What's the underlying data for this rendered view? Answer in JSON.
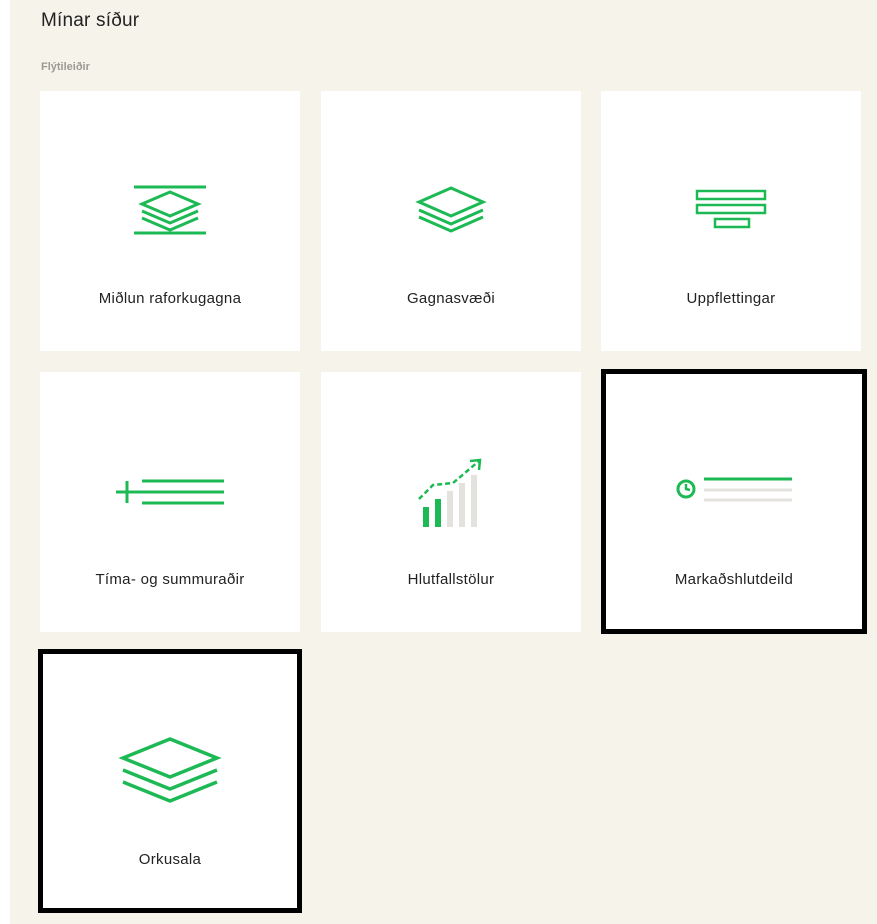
{
  "page": {
    "title": "Mínar síður",
    "subtitle": "Flýtileiðir"
  },
  "accent_color": "#1db954",
  "tiles": [
    {
      "label": "Miðlun raforkugagna",
      "icon": "layers-bracket-icon",
      "selected": false
    },
    {
      "label": "Gagnasvæði",
      "icon": "layers-icon",
      "selected": false
    },
    {
      "label": "Uppflettingar",
      "icon": "stacked-bars-icon",
      "selected": false
    },
    {
      "label": "Tíma- og summuraðir",
      "icon": "plus-lines-icon",
      "selected": false
    },
    {
      "label": "Hlutfallstölur",
      "icon": "growth-chart-icon",
      "selected": false
    },
    {
      "label": "Markaðshlutdeild",
      "icon": "clock-lines-icon",
      "selected": true
    },
    {
      "label": "Orkusala",
      "icon": "layers-large-icon",
      "selected": true
    }
  ]
}
